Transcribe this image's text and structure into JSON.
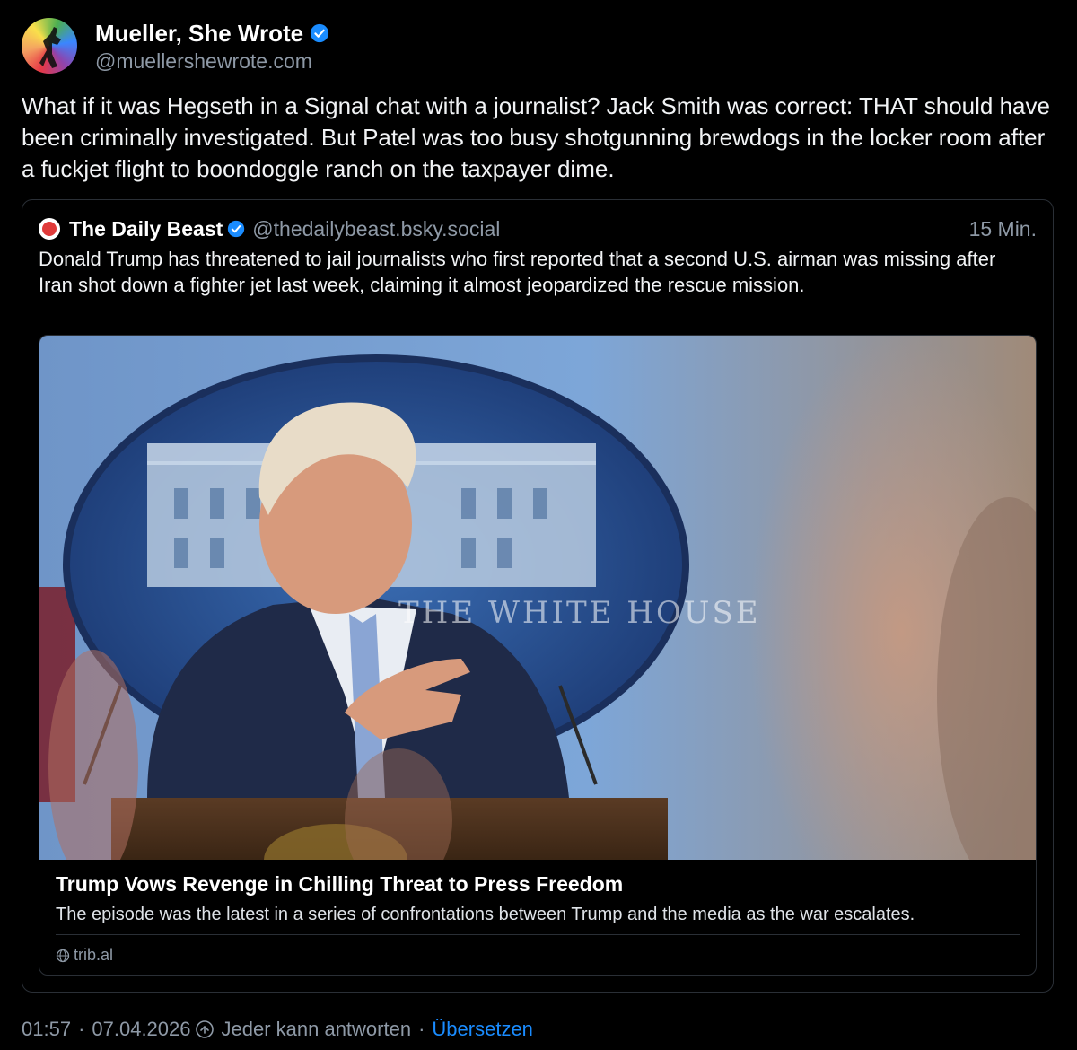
{
  "post": {
    "author_name": "Mueller, She Wrote",
    "author_handle": "@muellershewrote.com",
    "text": "What if it was Hegseth in a Signal chat with a journalist? Jack Smith was correct: THAT should have been criminally investigated. But Patel was too busy shotgunning brewdogs in the locker room after  a fuckjet flight to boondoggle ranch on the taxpayer dime."
  },
  "quote": {
    "author_name": "The Daily Beast",
    "author_handle": "@thedailybeast.bsky.social",
    "time": "15 Min.",
    "text": "Donald Trump has threatened to jail journalists who first reported that a second U.S. airman was missing after Iran shot down a fighter jet last week, claiming it almost jeopardized the rescue mission.",
    "card": {
      "image_caption_text": "THE WHITE HOUSE",
      "title": "Trump Vows Revenge in Chilling Threat to Press Freedom",
      "description": "The episode was the latest in a series of confrontations between Trump and the media as the war escalates.",
      "domain": "trib.al"
    }
  },
  "footer": {
    "time": "01:57",
    "date": "07.04.2026",
    "separator": "·",
    "reply_setting": "Jeder kann antworten",
    "translate_label": "Übersetzen"
  },
  "colors": {
    "background": "#000000",
    "text": "#f1f3f5",
    "muted": "#8e99a6",
    "accent": "#1a8cff",
    "border": "#2a2f36",
    "verified": "#1a8cff"
  },
  "icons": {
    "verified": "verified-badge-icon",
    "globe": "globe-icon",
    "reply_setting": "reply-setting-icon"
  }
}
